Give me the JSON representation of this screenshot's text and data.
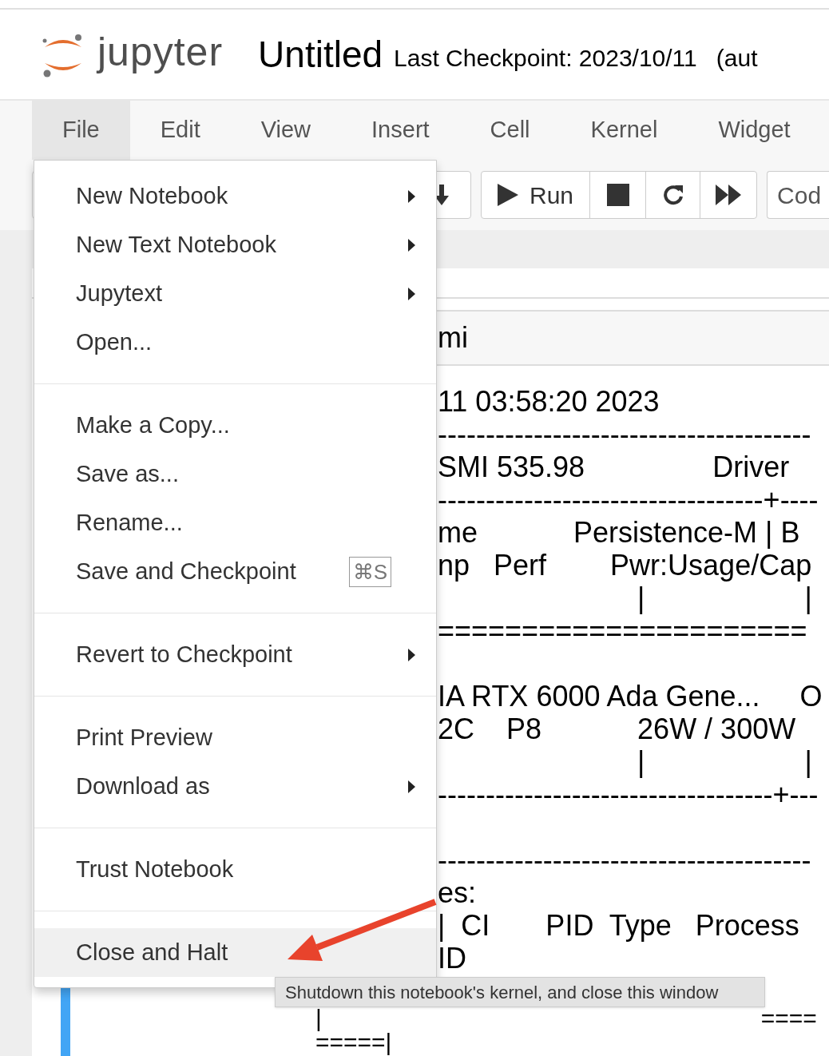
{
  "header": {
    "logo_text": "jupyter",
    "notebook_name": "Untitled",
    "checkpoint": "Last Checkpoint: 2023/10/11",
    "autosave": "(aut"
  },
  "menubar": [
    {
      "label": "File",
      "selected": true
    },
    {
      "label": "Edit",
      "selected": false
    },
    {
      "label": "View",
      "selected": false
    },
    {
      "label": "Insert",
      "selected": false
    },
    {
      "label": "Cell",
      "selected": false
    },
    {
      "label": "Kernel",
      "selected": false
    },
    {
      "label": "Widget",
      "selected": false
    }
  ],
  "toolbar": {
    "run_label": "Run",
    "cell_type": "Cod"
  },
  "cell": {
    "input": "mi",
    "output": [
      {
        "text": "11 03:58:20 2023",
        "kind": "covered"
      },
      {
        "text": "---------------------------------------",
        "kind": "covered"
      },
      {
        "text": "SMI 535.98                Driver",
        "kind": "covered"
      },
      {
        "text": "----------------------------------+----",
        "kind": "covered"
      },
      {
        "text": "me            Persistence-M | B",
        "kind": "covered"
      },
      {
        "text": "np   Perf        Pwr:Usage/Cap",
        "kind": "covered"
      },
      {
        "text": "                         |                    |",
        "kind": "covered"
      },
      {
        "text": "======================",
        "kind": "covered"
      },
      {
        "kind": "covered"
      },
      {
        "text": "IA RTX 6000 Ada Gene...     O",
        "kind": "covered"
      },
      {
        "text": "2C    P8            26W / 300W",
        "kind": "covered"
      },
      {
        "text": "                         |                    |",
        "kind": "covered"
      },
      {
        "text": "-----------------------------------+---",
        "kind": "covered"
      },
      {
        "kind": "covered"
      },
      {
        "text": "---------------------------------------",
        "kind": "covered"
      },
      {
        "text": "es:",
        "kind": "covered"
      },
      {
        "text": "|  CI       PID  Type   Process",
        "kind": "covered"
      },
      {
        "text": "ID",
        "kind": "covered"
      },
      {
        "text": "|",
        "kind": "open"
      },
      {
        "text": "=====|",
        "kind": "open"
      }
    ],
    "output_tail": "===="
  },
  "file_menu": {
    "groups": [
      [
        {
          "label": "New Notebook",
          "kind": "submenu",
          "selected": false
        },
        {
          "label": "New Text Notebook",
          "kind": "submenu",
          "selected": false
        },
        {
          "label": "Jupytext",
          "kind": "submenu",
          "selected": false
        },
        {
          "label": "Open...",
          "kind": "item",
          "selected": false
        }
      ],
      [
        {
          "label": "Make a Copy...",
          "kind": "item",
          "selected": false
        },
        {
          "label": "Save as...",
          "kind": "item",
          "selected": false
        },
        {
          "label": "Rename...",
          "kind": "item",
          "selected": false
        },
        {
          "label": "Save and Checkpoint",
          "kind": "shortcut",
          "shortcut": "⌘S",
          "selected": false
        }
      ],
      [
        {
          "label": "Revert to Checkpoint",
          "kind": "submenu",
          "selected": false
        }
      ],
      [
        {
          "label": "Print Preview",
          "kind": "item",
          "selected": false
        },
        {
          "label": "Download as",
          "kind": "submenu",
          "selected": false
        }
      ],
      [
        {
          "label": "Trust Notebook",
          "kind": "item",
          "selected": false
        }
      ],
      [
        {
          "label": "Close and Halt",
          "kind": "item",
          "selected": true
        }
      ]
    ]
  },
  "tooltip": "Shutdown this notebook's kernel, and close this window"
}
